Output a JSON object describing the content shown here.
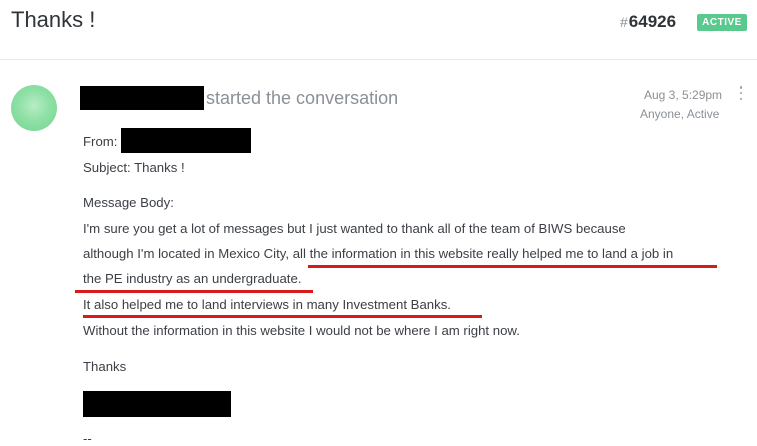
{
  "title": "Thanks !",
  "ticket": {
    "hash": "#",
    "number": "64926",
    "status": "ACTIVE"
  },
  "colors": {
    "status_badge": "#5ac98d",
    "underline": "#d81a1a",
    "avatar": "#8fe0a6"
  },
  "message": {
    "started_text": "started the conversation",
    "date": "Aug 3, 5:29pm",
    "meta": "Anyone, Active",
    "from_label": "From:",
    "subject": "Subject: Thanks !",
    "body_label": "Message Body:",
    "line1": "I'm sure you get a lot of messages but I just wanted to thank all of the team of BIWS because",
    "line2a": "although I'm located in Mexico City, ",
    "line2b": "all the information in this website really helped me to land a job in",
    "line3a": "the PE industry as an undergraduate",
    "line3b": ".",
    "line4": "It also helped me to land interviews in many Investment Banks.",
    "line5": "Without the information in this website I would not be where I am right now.",
    "thanks": "Thanks",
    "signoff": "--"
  },
  "icons": {
    "avatar": "avatar",
    "menu": "kebab-menu-icon"
  }
}
